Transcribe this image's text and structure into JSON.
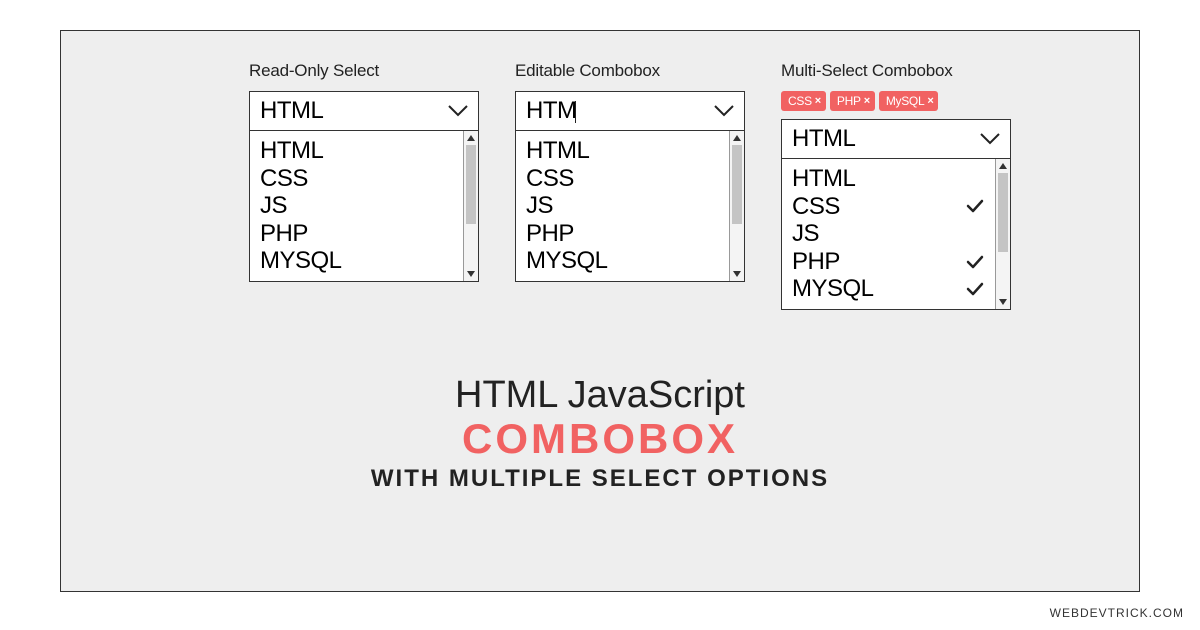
{
  "readonly": {
    "label": "Read-Only Select",
    "value": "HTML",
    "options": [
      "HTML",
      "CSS",
      "JS",
      "PHP",
      "MYSQL"
    ]
  },
  "editable": {
    "label": "Editable Combobox",
    "value": "HTM",
    "options": [
      "HTML",
      "CSS",
      "JS",
      "PHP",
      "MYSQL"
    ]
  },
  "multi": {
    "label": "Multi-Select Combobox",
    "tags": [
      "CSS",
      "PHP",
      "MySQL"
    ],
    "value": "HTML",
    "options": [
      {
        "label": "HTML",
        "checked": false
      },
      {
        "label": "CSS",
        "checked": true
      },
      {
        "label": "JS",
        "checked": false
      },
      {
        "label": "PHP",
        "checked": true
      },
      {
        "label": "MYSQL",
        "checked": true
      }
    ]
  },
  "headline": {
    "line1": "HTML JavaScript",
    "line2": "COMBOBOX",
    "line3": "WITH MULTIPLE SELECT OPTIONS"
  },
  "watermark": "WEBDEVTRICK.COM",
  "colors": {
    "accent": "#f16262",
    "frame_bg": "#eeeeee"
  }
}
